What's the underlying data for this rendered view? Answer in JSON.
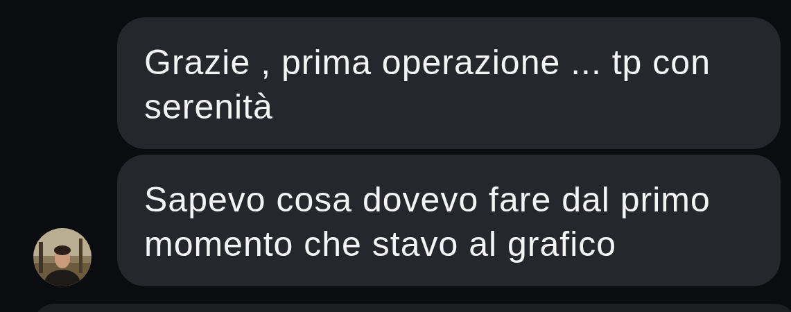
{
  "messages": [
    {
      "text": "Grazie , prima operazione ... tp con serenità",
      "avatar": false
    },
    {
      "text": "Sapevo cosa dovevo fare dal primo momento che stavo al grafico",
      "avatar": true
    }
  ]
}
